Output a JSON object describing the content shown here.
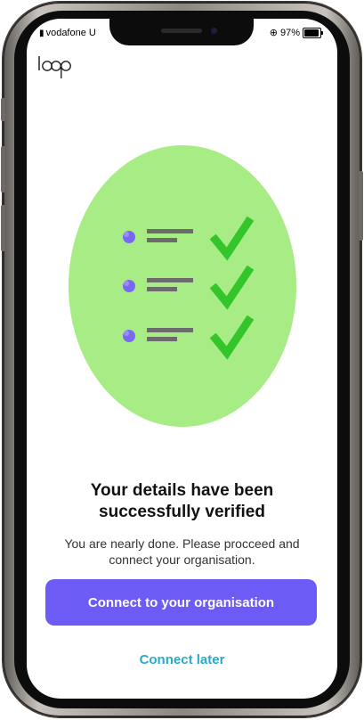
{
  "status_bar": {
    "carrier": "vodafone U",
    "battery": "97%"
  },
  "app": {
    "logo_text": "loop"
  },
  "illustration": {
    "icon": "checklist-verified-illustration",
    "rows": 3,
    "circle_color": "#a8ec86",
    "check_color": "#33c52a",
    "bullet_color": "#7a68f5"
  },
  "content": {
    "title": "Your details have been successfully verified",
    "subtitle": "You are nearly done. Please procceed and connect your organisation."
  },
  "actions": {
    "primary_label": "Connect to your organisation",
    "secondary_label": "Connect later"
  },
  "colors": {
    "primary": "#6c5cf5",
    "link": "#2aa9c9"
  }
}
